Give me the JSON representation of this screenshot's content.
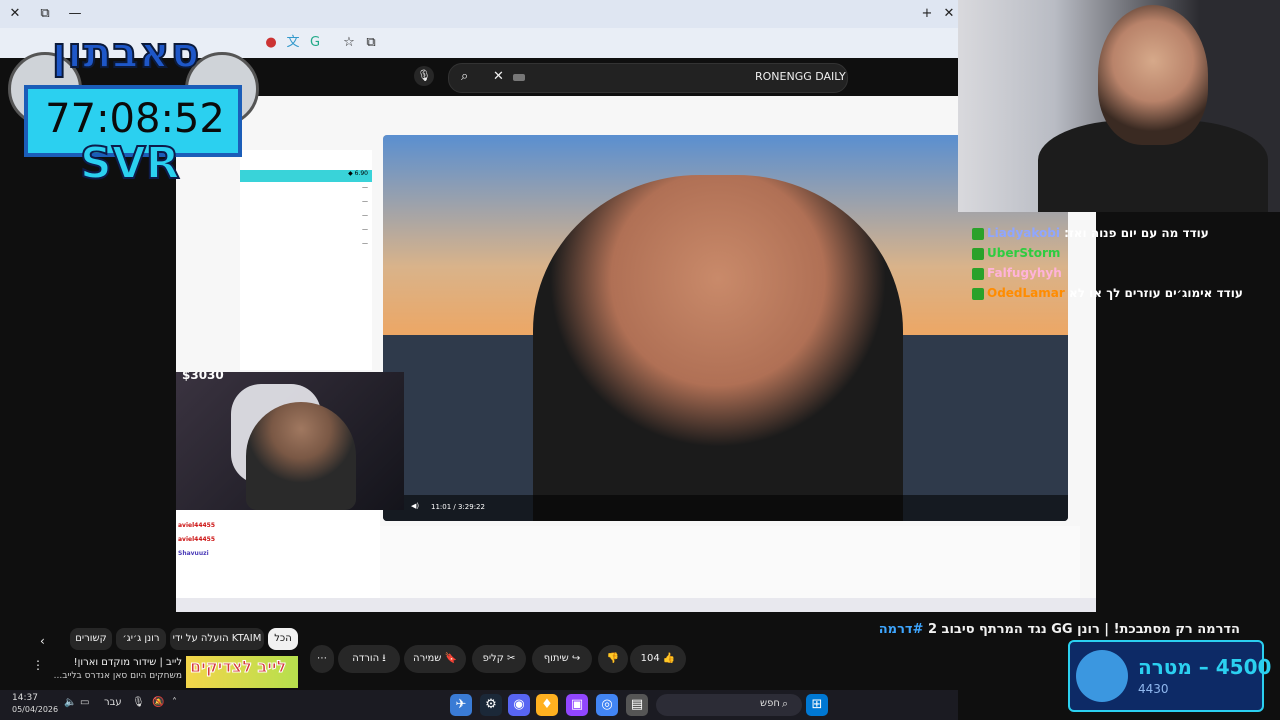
{
  "browser": {
    "controls": [
      "×",
      "⧉",
      "—"
    ],
    "window_controls": [
      "+",
      "—",
      "×"
    ]
  },
  "search": {
    "channel": "RONENGG DAILY"
  },
  "overlay": {
    "logo_text": "סאבתון",
    "timer": "77:08:52",
    "svr": "SVR"
  },
  "chat": {
    "rows": [
      {
        "user": "Liadyakobi",
        "message": ":עודד מה עם יום פנוה ואז",
        "color": "#6a5acd"
      },
      {
        "user": "UberStorm",
        "message": "",
        "color": "#2ecc40"
      },
      {
        "user": "Falfugyhyh",
        "message": "",
        "color": "#ffb3d9"
      },
      {
        "user": "OdedLamar",
        "message": "עודד אימוג׳ים עוזרים לך או לא",
        "color": "#ff8c00"
      }
    ]
  },
  "video": {
    "time": "11:01 / 3:29:22",
    "title": "הדרמה רק מסתבכת! | רונן GG נגד המרתף סיבוב 2",
    "hashtag": "#דרמה",
    "likes": "104",
    "share": "שיתוף",
    "clip": "קליפ",
    "save": "שמירה",
    "download": "הורדה"
  },
  "chips": [
    "הכל",
    "הועלה על ידי KTAIM",
    "רונן ג׳יג׳",
    "קשורים"
  ],
  "rec": {
    "title": "לייב | שידור מוקדם וארון!",
    "subtitle": "משחקים היום סאן אנדרס בלייב...",
    "thumb_label": "לייב לצדיקים"
  },
  "goal": {
    "target": "4500 – מטרה",
    "current": "4430"
  },
  "taskbar": {
    "time": "14:37",
    "date": "05/04/2026",
    "lang": "עבר",
    "search_placeholder": "חפש"
  },
  "inner": {
    "cam_overlay": "$3030",
    "chat_users": [
      "aviel44455",
      "aviel44455",
      "Shavuuzi"
    ]
  }
}
